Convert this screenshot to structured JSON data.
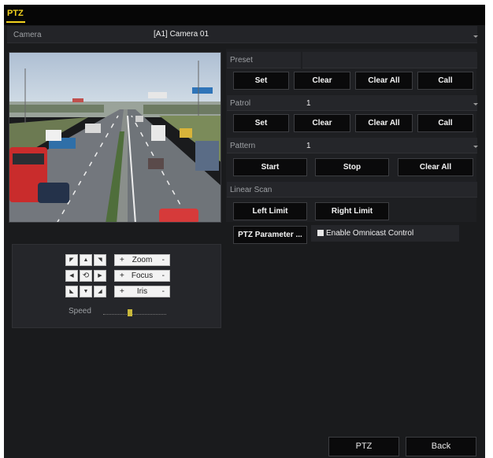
{
  "window": {
    "title": "PTZ"
  },
  "camera": {
    "label": "Camera",
    "value": "[A1] Camera 01"
  },
  "preset": {
    "label": "Preset",
    "buttons": {
      "set": "Set",
      "clear": "Clear",
      "clear_all": "Clear All",
      "call": "Call"
    }
  },
  "patrol": {
    "label": "Patrol",
    "value": "1",
    "buttons": {
      "set": "Set",
      "clear": "Clear",
      "clear_all": "Clear All",
      "call": "Call"
    }
  },
  "pattern": {
    "label": "Pattern",
    "value": "1",
    "buttons": {
      "start": "Start",
      "stop": "Stop",
      "clear_all": "Clear All"
    }
  },
  "linear_scan": {
    "label": "Linear Scan",
    "buttons": {
      "left_limit": "Left Limit",
      "right_limit": "Right Limit"
    }
  },
  "ptz_parameter_button": "PTZ Parameter ...",
  "omnicast": {
    "label": "Enable Omnicast Control",
    "checked": true
  },
  "ptz_control": {
    "zoom": "Zoom",
    "focus": "Focus",
    "iris": "Iris",
    "plus": "+",
    "minus": "-",
    "speed_label": "Speed",
    "speed_level": 0.42
  },
  "footer": {
    "ptz": "PTZ",
    "back": "Back"
  },
  "colors": {
    "accent": "#f2d21e",
    "panel": "#1a1b1d",
    "button": "#0a0a0b"
  }
}
